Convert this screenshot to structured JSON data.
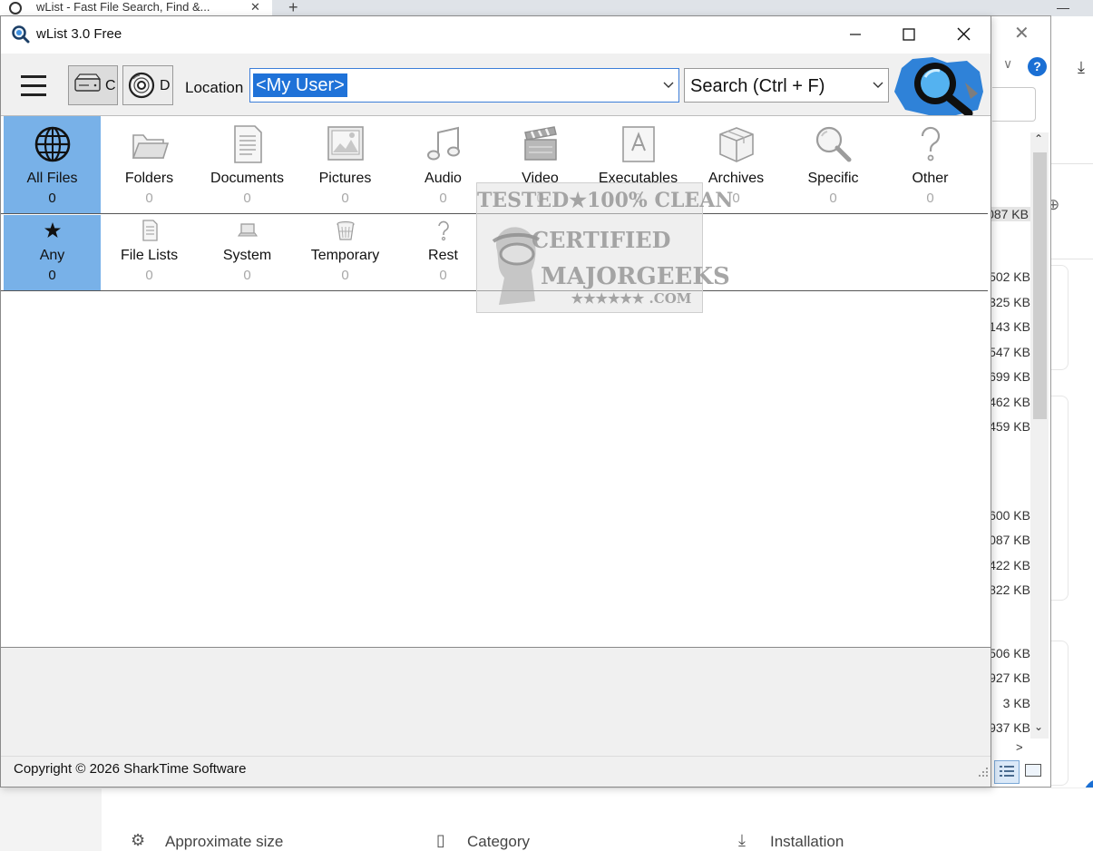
{
  "window": {
    "title": "wList 3.0 Free"
  },
  "toolbar": {
    "drives": [
      {
        "letter": "C"
      },
      {
        "letter": "D"
      }
    ],
    "location_label": "Location",
    "location_value": "<My User>",
    "search_placeholder": "Search (Ctrl + F)"
  },
  "categories_row1": [
    {
      "label": "All Files",
      "count": "0",
      "icon": "globe-icon",
      "selected": true
    },
    {
      "label": "Folders",
      "count": "0",
      "icon": "folder-icon"
    },
    {
      "label": "Documents",
      "count": "0",
      "icon": "document-icon"
    },
    {
      "label": "Pictures",
      "count": "0",
      "icon": "picture-icon"
    },
    {
      "label": "Audio",
      "count": "0",
      "icon": "music-note-icon"
    },
    {
      "label": "Video",
      "count": "0",
      "icon": "clapperboard-icon"
    },
    {
      "label": "Executables",
      "count": "0",
      "icon": "executable-icon"
    },
    {
      "label": "Archives",
      "count": "0",
      "icon": "archive-box-icon"
    },
    {
      "label": "Specific",
      "count": "0",
      "icon": "magnifier-icon"
    },
    {
      "label": "Other",
      "count": "0",
      "icon": "question-mark-icon"
    }
  ],
  "categories_row2": [
    {
      "label": "Any",
      "count": "0",
      "icon": "star-icon",
      "selected": true
    },
    {
      "label": "File Lists",
      "count": "0",
      "icon": "file-list-icon"
    },
    {
      "label": "System",
      "count": "0",
      "icon": "laptop-icon"
    },
    {
      "label": "Temporary",
      "count": "0",
      "icon": "trash-bin-icon"
    },
    {
      "label": "Rest",
      "count": "0",
      "icon": "question-mark-icon"
    }
  ],
  "status": {
    "text": "Copyright © 2026 SharkTime Software"
  },
  "watermark": {
    "line1": "TESTED★100% CLEAN",
    "line2": "CERTIFIED",
    "line3": "MAJORGEEKS",
    "line4": "★★★★★★ .COM"
  },
  "background_browser": {
    "tab_title": "wList - Fast File Search, Find &...",
    "sizes_top": [
      "087 KB"
    ],
    "sizes_group1": [
      "502 KB",
      "325 KB",
      "143 KB",
      "547 KB",
      "699 KB",
      "462 KB",
      "459 KB"
    ],
    "sizes_group2": [
      "600 KB",
      "087 KB",
      "422 KB",
      "822 KB"
    ],
    "sizes_group3": [
      "506 KB",
      "927 KB",
      "3 KB",
      "937 KB"
    ],
    "footer_items": [
      {
        "label": "Approximate size"
      },
      {
        "label": "Category"
      },
      {
        "label": "Installation"
      }
    ]
  },
  "colors": {
    "selected_category": "#78b1e8",
    "location_highlight": "#1f72d8",
    "toolbar_bg": "#f0f0f0"
  }
}
